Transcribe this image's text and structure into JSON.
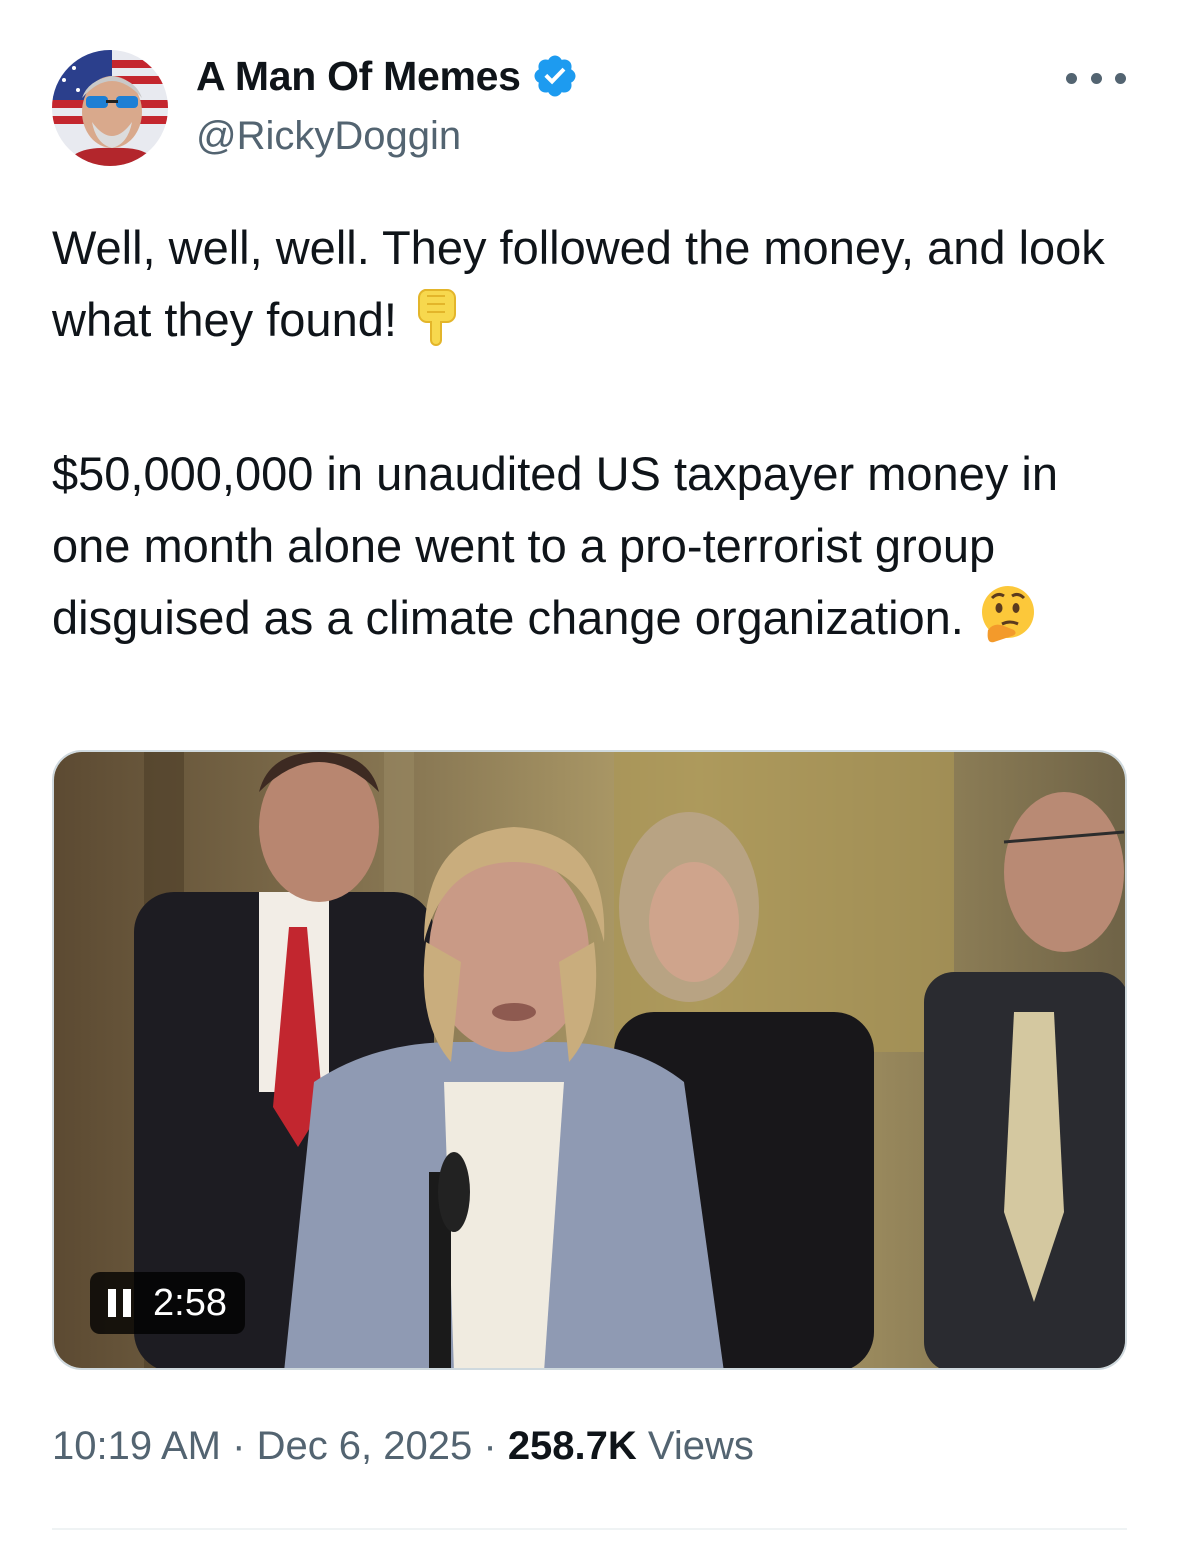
{
  "author": {
    "display_name": "A Man Of Memes",
    "handle": "@RickyDoggin",
    "verified": true,
    "verified_color": "#1d9bf0"
  },
  "tweet": {
    "line1": "Well, well, well. They followed the money, and look what they found!",
    "line1_emoji": "pointing-down-icon",
    "line2": "$50,000,000 in unaudited US taxpayer money in one month alone went to a pro-terrorist group disguised as a climate change organization.",
    "line2_emoji": "thinking-face-icon"
  },
  "media": {
    "type": "video",
    "state": "playing",
    "remaining_time": "2:58"
  },
  "meta": {
    "time": "10:19 AM",
    "date": "Dec 6, 2025",
    "views_count": "258.7K",
    "views_label": "Views"
  },
  "colors": {
    "text": "#0f1419",
    "secondary": "#536471",
    "accent": "#1d9bf0"
  }
}
